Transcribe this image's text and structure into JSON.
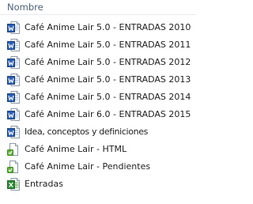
{
  "column": {
    "header": "Nombre"
  },
  "files": [
    {
      "name": "Café Anime Lair 5.0 - ENTRADAS 2010",
      "icon": "word-document-icon"
    },
    {
      "name": "Café Anime Lair 5.0 - ENTRADAS 2011",
      "icon": "word-document-icon"
    },
    {
      "name": "Café Anime Lair 5.0 - ENTRADAS 2012",
      "icon": "word-document-icon"
    },
    {
      "name": "Café Anime Lair 5.0 - ENTRADAS 2013",
      "icon": "word-document-icon"
    },
    {
      "name": "Café Anime Lair 5.0 - ENTRADAS 2014",
      "icon": "word-document-icon"
    },
    {
      "name": "Café Anime Lair 6.0 - ENTRADAS 2015",
      "icon": "word-document-icon"
    },
    {
      "name": "Idea, conceptos y definiciones",
      "icon": "word-document-icon"
    },
    {
      "name": "Café Anime Lair - HTML",
      "icon": "generic-document-icon"
    },
    {
      "name": "Café Anime Lair - Pendientes",
      "icon": "generic-document-icon"
    },
    {
      "name": "Entradas",
      "icon": "spreadsheet-document-icon"
    }
  ]
}
